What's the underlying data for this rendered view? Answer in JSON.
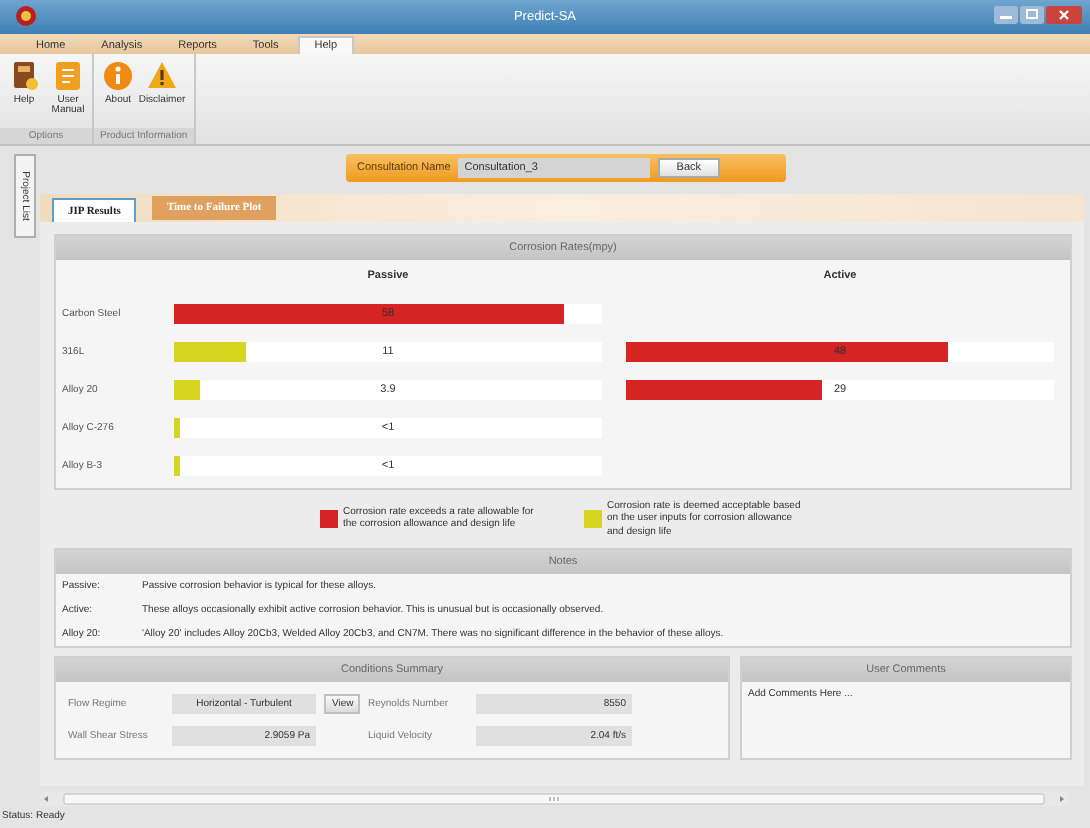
{
  "window": {
    "title": "Predict-SA"
  },
  "menu": [
    {
      "label": "Home",
      "selected": false
    },
    {
      "label": "Analysis",
      "selected": false
    },
    {
      "label": "Reports",
      "selected": false
    },
    {
      "label": "Tools",
      "selected": false
    },
    {
      "label": "Help",
      "selected": true
    }
  ],
  "ribbon": {
    "groups": [
      {
        "label": "Options",
        "buttons": [
          {
            "label": "Help",
            "kind": "book"
          },
          {
            "label": "User Manual",
            "kind": "manual"
          }
        ]
      },
      {
        "label": "Product Information",
        "buttons": [
          {
            "label": "About",
            "kind": "info"
          },
          {
            "label": "Disclaimer",
            "kind": "warning"
          }
        ]
      }
    ]
  },
  "side_tab": {
    "label": "Project List"
  },
  "consultation": {
    "label": "Consultation Name",
    "value": "Consultation_3",
    "button": "Back"
  },
  "tabs": [
    {
      "label": "JIP Results",
      "selected": true
    },
    {
      "label": "Time to Failure Plot",
      "selected": false
    }
  ],
  "corrosion": {
    "title": "Corrosion Rates(mpy)",
    "columns": [
      "Passive",
      "Active"
    ],
    "rows": [
      {
        "name": "Carbon Steel",
        "passive": {
          "level": 0.91,
          "reading": "58",
          "color": "#d42424"
        }
      },
      {
        "name": "316L",
        "passive": {
          "level": 0.17,
          "reading": "11",
          "color": "#d6d620"
        },
        "active": {
          "level": 0.75,
          "reading": "48",
          "color": "#d42424"
        }
      },
      {
        "name": "Alloy 20",
        "passive": {
          "level": 0.06,
          "reading": "3.9",
          "color": "#d6d620"
        },
        "active": {
          "level": 0.46,
          "reading": "29",
          "color": "#d42424"
        }
      },
      {
        "name": "Alloy C-276",
        "passive": {
          "level": 0.015,
          "reading": "<1",
          "color": "#d6d620"
        }
      },
      {
        "name": "Alloy B-3",
        "passive": {
          "level": 0.015,
          "reading": "<1",
          "color": "#d6d620"
        }
      }
    ]
  },
  "legend": [
    {
      "color": "#d42424",
      "text": "Corrosion rate exceeds a rate allowable for the corrosion allowance and design life"
    },
    {
      "color": "#d6d620",
      "text": "Corrosion rate is deemed acceptable based on the user inputs for corrosion allowance and design life"
    }
  ],
  "notes": {
    "title": "Notes",
    "items": [
      {
        "term": "Passive:",
        "text": "Passive corrosion behavior is typical for these alloys."
      },
      {
        "term": "Active:",
        "text": "These alloys occasionally exhibit active corrosion behavior. This is unusual but is occasionally observed."
      },
      {
        "term": "Alloy 20:",
        "text": "'Alloy 20' includes Alloy 20Cb3, Welded Alloy 20Cb3, and CN7M. There was no significant difference in the behavior of these alloys."
      }
    ]
  },
  "conditions": {
    "title": "Conditions Summary",
    "fields": [
      {
        "label": "Flow Regime",
        "value": "Horizontal - Turbulent",
        "button": "View"
      },
      {
        "label": "Reynolds Number",
        "value": "8550"
      },
      {
        "label": "Wall Shear Stress",
        "value": "2.9059 Pa"
      },
      {
        "label": "Liquid Velocity",
        "value": "2.04 ft/s"
      }
    ]
  },
  "comments": {
    "title": "User Comments",
    "placeholder": "Add Comments Here ..."
  },
  "status_bar": "Status: Ready"
}
